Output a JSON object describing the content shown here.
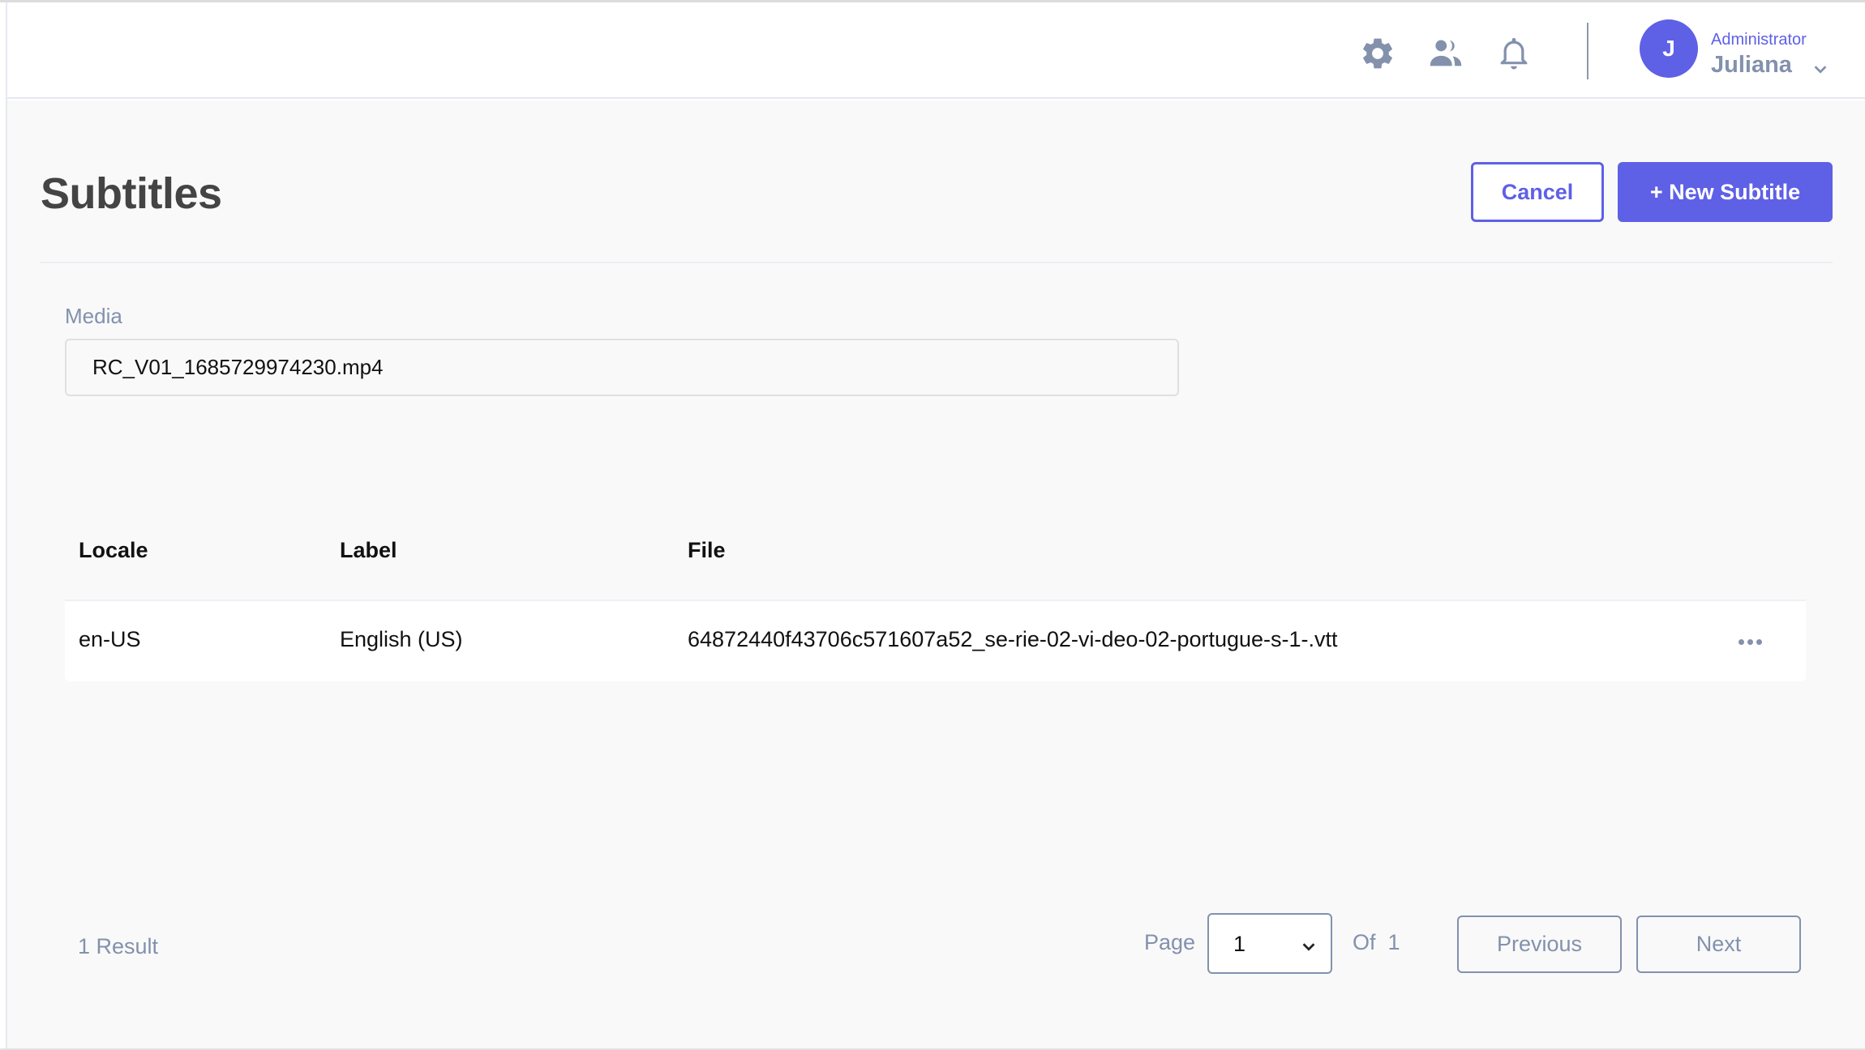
{
  "header": {
    "icons": {
      "settings": "gear-icon",
      "team": "users-icon",
      "notifications": "bell-icon"
    },
    "user": {
      "avatar_initial": "J",
      "role": "Administrator",
      "name": "Juliana"
    }
  },
  "page": {
    "title": "Subtitles",
    "cancel_label": "Cancel",
    "new_label": "+ New Subtitle"
  },
  "media": {
    "label": "Media",
    "value": "RC_V01_1685729974230.mp4"
  },
  "table": {
    "columns": [
      "Locale",
      "Label",
      "File"
    ],
    "rows": [
      {
        "locale": "en-US",
        "label": "English (US)",
        "file": "64872440f43706c571607a52_se-rie-02-vi-deo-02-portugue-s-1-.vtt"
      }
    ]
  },
  "footer": {
    "result_count": "1 Result",
    "page_label": "Page",
    "current_page": "1",
    "of_label": "Of",
    "total_pages": "1",
    "previous_label": "Previous",
    "next_label": "Next"
  },
  "colors": {
    "accent": "#5e60e6",
    "muted": "#8391ad",
    "title": "#444444",
    "background": "#f9f9f9"
  }
}
